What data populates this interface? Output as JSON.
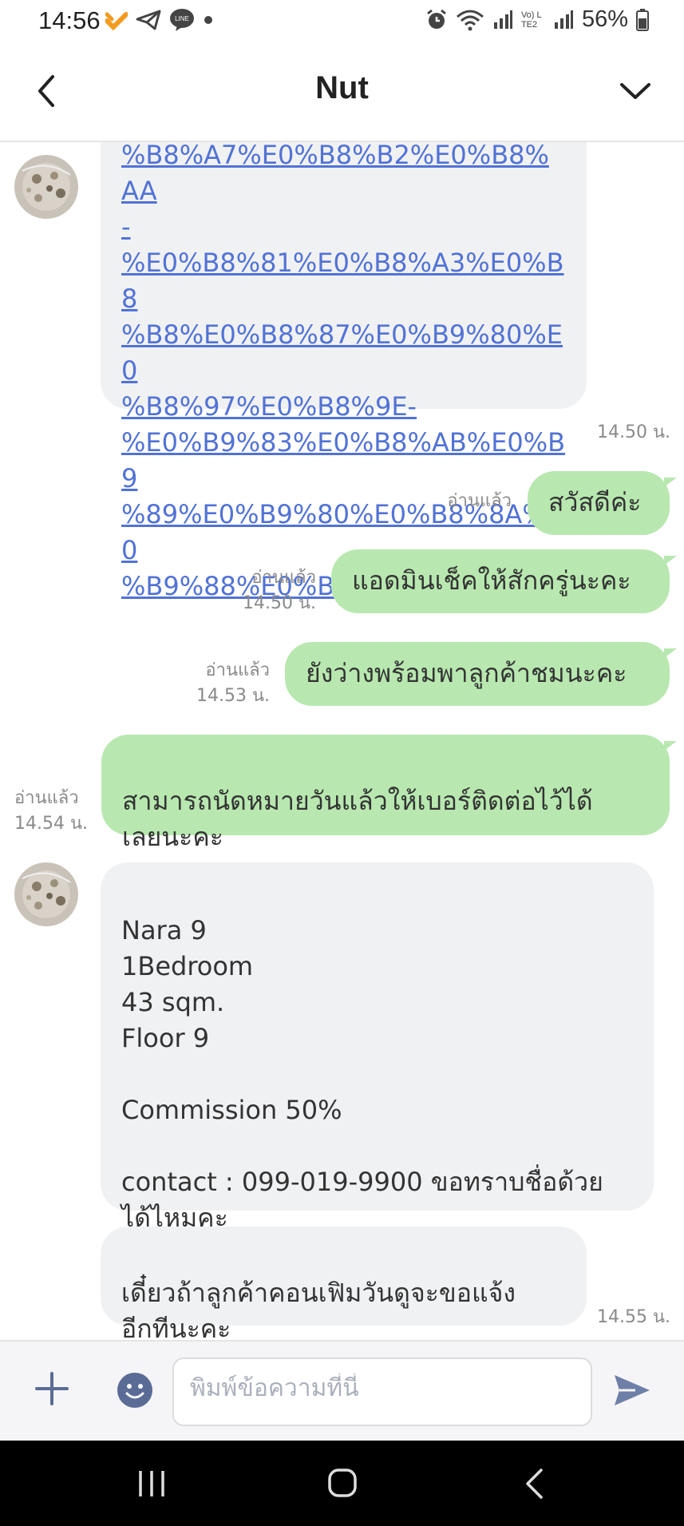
{
  "status_bar": {
    "time": "14:56",
    "battery": "56%",
    "network_label": "Vo) LTE2",
    "icons": [
      "notification-app-icon",
      "telegram-icon",
      "line-icon",
      "dot-icon",
      "alarm-icon",
      "wifi-icon",
      "signal-icon",
      "volte-icon",
      "signal-icon",
      "battery-icon"
    ]
  },
  "header": {
    "title": "Nut",
    "back_icon": "chevron-left-icon",
    "menu_icon": "chevron-down-icon"
  },
  "messages": [
    {
      "direction": "incoming",
      "type": "link",
      "lines": [
        "%B8%A7%E0%B8%B2%E0%B8%AA",
        "-",
        "%E0%B8%81%E0%B8%A3%E0%B8",
        "%B8%E0%B8%87%E0%B9%80%E0",
        "%B8%97%E0%B8%9E-",
        "%E0%B9%83%E0%B8%AB%E0%B9",
        "%89%E0%B9%80%E0%B8%8A%E0",
        "%B9%88%E0%B8%B2-10710638"
      ],
      "time": "14.50 น."
    },
    {
      "direction": "outgoing",
      "text": "สวัสดีค่ะ",
      "read": "อ่านแล้ว",
      "time": ""
    },
    {
      "direction": "outgoing",
      "text": "แอดมินเช็คให้สักครู่นะคะ",
      "read": "อ่านแล้ว",
      "time": "14.50 น."
    },
    {
      "direction": "outgoing",
      "text": "ยังว่างพร้อมพาลูกค้าชมนะคะ",
      "read": "อ่านแล้ว",
      "time": "14.53 น."
    },
    {
      "direction": "outgoing",
      "text": "สามารถนัดหมายวันแล้วให้เบอร์ติดต่อไว้ได้\nเลยนะคะ",
      "read": "อ่านแล้ว",
      "time": "14.54 น."
    },
    {
      "direction": "incoming",
      "text": "Nara 9\n1Bedroom\n43 sqm.\nFloor 9\n\nCommission 50%\n\ncontact : 099-019-9900 ขอทราบชื่อด้วย\nได้ไหมคะ",
      "time": ""
    },
    {
      "direction": "incoming",
      "text": "เดี๋ยวถ้าลูกค้าคอนเฟิมวันดูจะขอแจ้ง\nอีกทีนะคะ",
      "time": "14.55 น."
    }
  ],
  "input_bar": {
    "placeholder": "พิมพ์ข้อความที่นี่",
    "value": "",
    "icons": [
      "plus-icon",
      "emoji-icon",
      "send-icon"
    ]
  },
  "nav_bar": {
    "icons": [
      "recent-apps-icon",
      "home-icon",
      "back-icon"
    ]
  },
  "colors": {
    "outgoing_bubble": "#b8e8b0",
    "incoming_bubble": "#f0f1f3",
    "link": "#5172d6",
    "send_icon": "#6e80a8",
    "emoji_icon": "#5a6c96"
  }
}
